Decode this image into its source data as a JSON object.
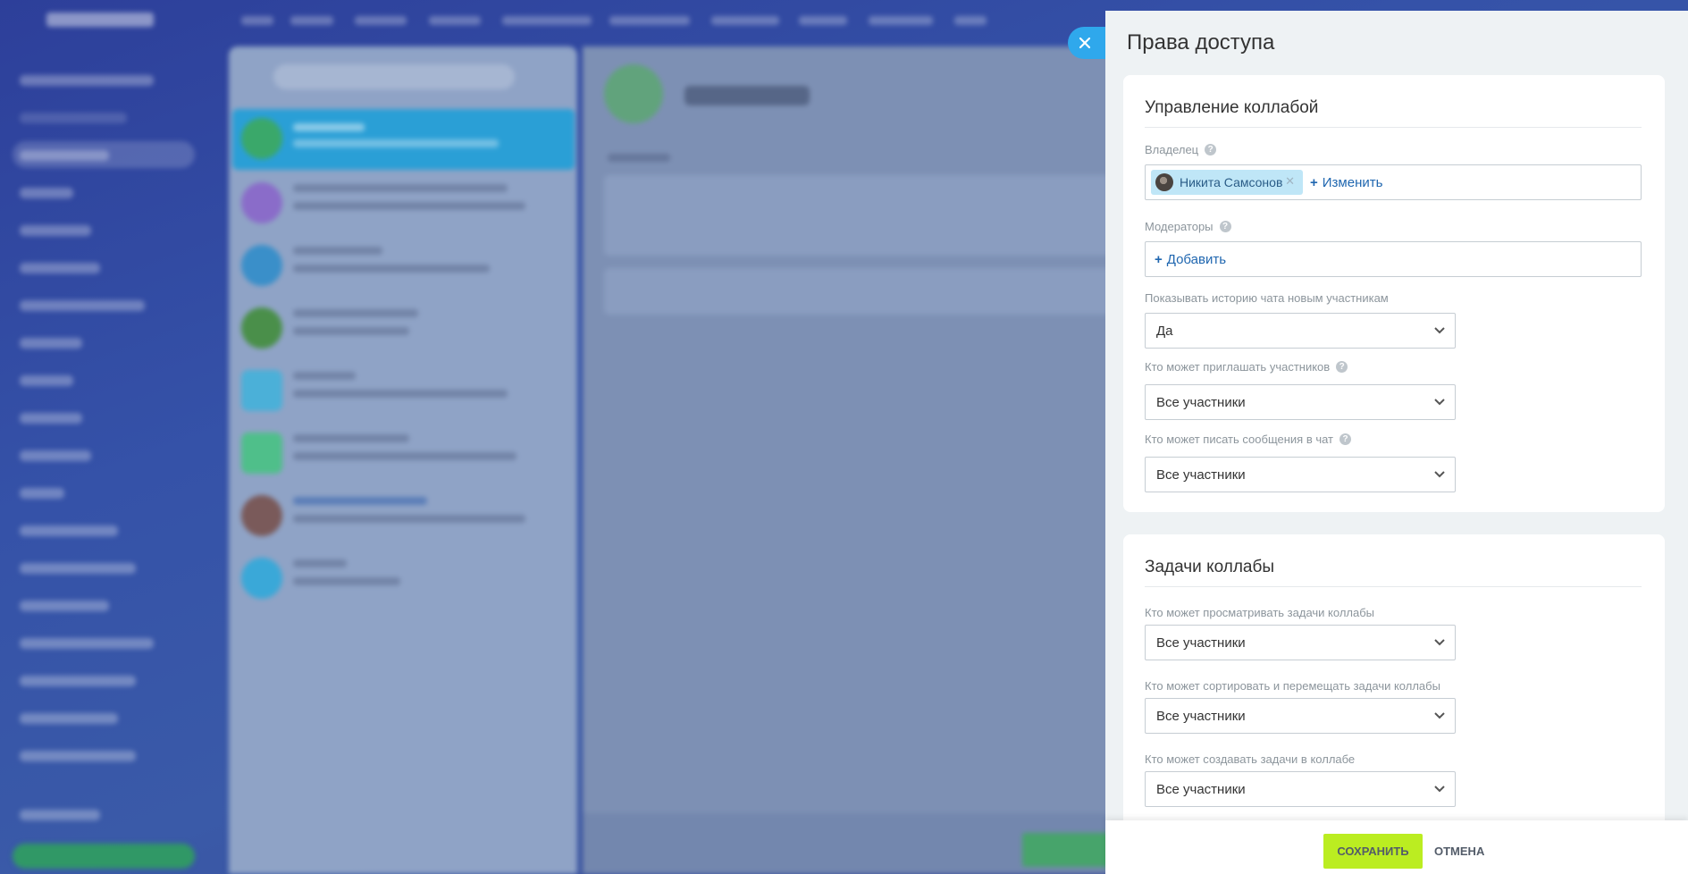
{
  "panel": {
    "title": "Права доступа",
    "close_icon": "close-icon"
  },
  "section_management": {
    "title": "Управление коллабой",
    "owner": {
      "label": "Владелец",
      "name": "Никита Самсонов",
      "change_label": "Изменить"
    },
    "moderators": {
      "label": "Модераторы",
      "add_label": "Добавить"
    },
    "history": {
      "label": "Показывать историю чата новым участникам",
      "value": "Да"
    },
    "invite": {
      "label": "Кто может приглашать участников",
      "value": "Все участники"
    },
    "write": {
      "label": "Кто может писать сообщения в чат",
      "value": "Все участники"
    }
  },
  "section_tasks": {
    "title": "Задачи коллабы",
    "view": {
      "label": "Кто может просматривать задачи коллабы",
      "value": "Все участники"
    },
    "sort": {
      "label": "Кто может сортировать и перемещать задачи коллабы",
      "value": "Все участники"
    },
    "create": {
      "label": "Кто может создавать задачи в коллабе",
      "value": "Все участники"
    }
  },
  "footer": {
    "save_label": "СОХРАНИТЬ",
    "cancel_label": "ОТМЕНА"
  },
  "colors": {
    "accent_link": "#2067b0",
    "save_button": "#bbed21",
    "close_button": "#2fa8ec",
    "owner_chip": "#bfe6f7"
  }
}
